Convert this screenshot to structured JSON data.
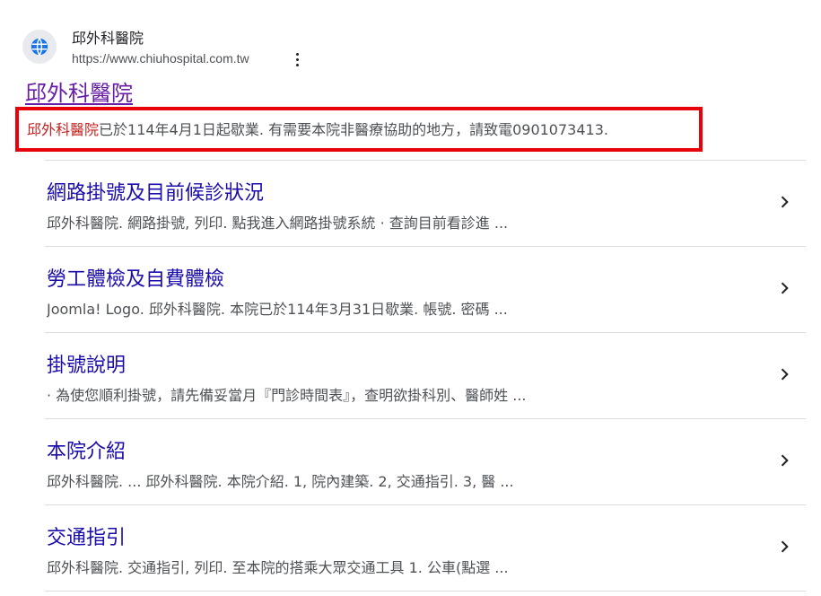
{
  "site": {
    "name": "邱外科醫院",
    "url": "https://www.chiuhospital.com.tw",
    "favicon_icon": "globe-icon",
    "menu_icon": "more-vert-icon"
  },
  "result": {
    "title": "邱外科醫院",
    "snippet_highlight": "邱外科醫院",
    "snippet_rest": "已於114年4月1日起歇業. 有需要本院非醫療協助的地方，請致電0901073413.",
    "highlight_border_color": "#e8000b"
  },
  "sitelinks": [
    {
      "title": "網路掛號及目前候診狀況",
      "desc": "邱外科醫院. 網路掛號, 列印. 點我進入網路掛號系統 · 查詢目前看診進 ..."
    },
    {
      "title": "勞工體檢及自費體檢",
      "desc": "Joomla! Logo. 邱外科醫院. 本院已於114年3月31日歇業. 帳號. 密碼 ..."
    },
    {
      "title": "掛號說明",
      "desc": "· 為使您順利掛號，請先備妥當月『門診時間表』，查明欲掛科別、醫師姓 ..."
    },
    {
      "title": "本院介紹",
      "desc": "邱外科醫院. ... 邱外科醫院. 本院介紹. 1, 院內建築. 2, 交通指引. 3, 醫 ..."
    },
    {
      "title": "交通指引",
      "desc": "邱外科醫院. 交通指引, 列印. 至本院的搭乘大眾交通工具 1. 公車(點選 ..."
    }
  ],
  "colors": {
    "link_title": "#1a0dab",
    "visited_title": "#681da8",
    "snippet_text": "#4d5156"
  }
}
